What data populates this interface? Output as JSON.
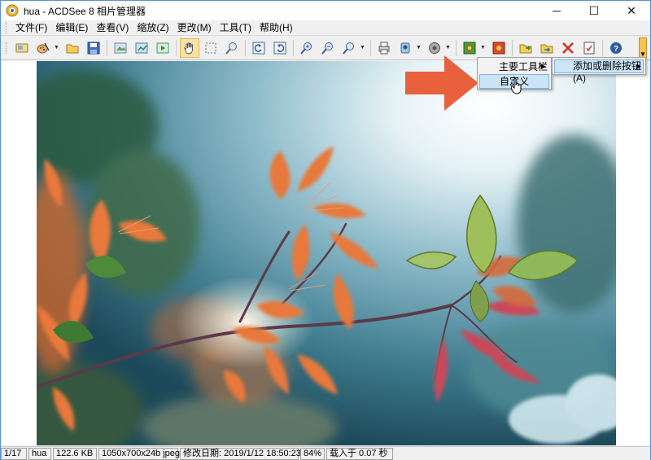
{
  "window": {
    "title": "hua - ACDSee 8 相片管理器",
    "minimize_glyph": "─",
    "maximize_glyph": "☐",
    "close_glyph": "✕"
  },
  "menu": {
    "items": [
      "文件(F)",
      "编辑(E)",
      "查看(V)",
      "缩放(Z)",
      "更改(M)",
      "工具(T)",
      "帮助(H)"
    ]
  },
  "toolbar": {
    "buttons": [
      "browse-icon",
      "edit-icon",
      "open-folder-icon",
      "save-icon",
      "prev-image-icon",
      "full-screen-icon",
      "next-image-icon",
      "hand-tool-icon",
      "select-tool-icon",
      "zoom-tool-icon",
      "rotate-left-icon",
      "rotate-right-icon",
      "zoom-in-icon",
      "zoom-out-icon",
      "zoom-menu-icon",
      "print-icon",
      "acquire-icon",
      "audio-icon",
      "set-wallpaper-center-icon",
      "set-wallpaper-tile-icon",
      "copy-to-folder-icon",
      "move-to-folder-icon",
      "delete-icon",
      "properties-icon",
      "help-icon"
    ],
    "accent_color": "#f6c35a"
  },
  "context_menu": {
    "items": [
      {
        "label": "主要工具栏",
        "has_submenu": true
      },
      {
        "label": "自定义",
        "has_submenu": false,
        "highlighted": true
      }
    ],
    "submenu_item": "添加或删除按钮(A)"
  },
  "status": {
    "index": "1/17",
    "name": "hua",
    "size": "122.6 KB",
    "info": "1050x700x24b jpeg",
    "modified": "修改日期: 2019/1/12 18:50:23",
    "zoom": "84%",
    "load_time": "载入于 0.07 秒"
  },
  "colors": {
    "annotation_arrow": "#e8603c",
    "highlight": "#cce4f7",
    "window_border": "#5a8fd6"
  }
}
